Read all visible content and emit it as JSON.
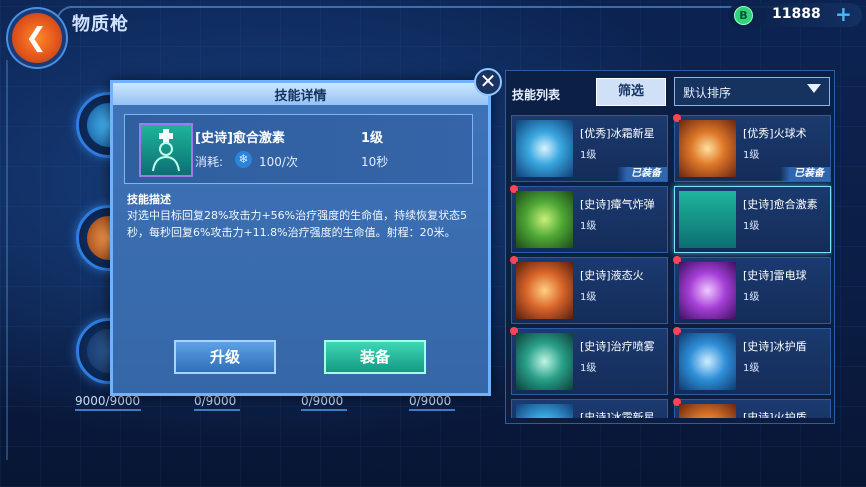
{
  "header": {
    "title": "物质枪",
    "back_icon": "back-arrow-icon"
  },
  "currency": {
    "icon": "B",
    "value": "11888",
    "add_label": "+"
  },
  "slots": {
    "progress": [
      "9000/9000",
      "0/9000",
      "0/9000",
      "0/9000"
    ]
  },
  "dialog": {
    "title": "技能详情",
    "close_label": "✕",
    "skill": {
      "name": "[史诗]愈合激素",
      "level": "1级",
      "cost_label": "消耗:",
      "cost_icon": "❄",
      "cost_value": "100/次",
      "cooldown": "10秒"
    },
    "description_title": "技能描述",
    "description": "对选中目标回复28%攻击力+56%治疗强度的生命值，持续恢复状态5秒，每秒回复6%攻击力+11.8%治疗强度的生命值。射程：20米。",
    "upgrade_label": "升级",
    "equip_label": "装备"
  },
  "skill_list": {
    "title": "技能列表",
    "filter_label": "筛选",
    "sort_value": "默认排序",
    "items": [
      {
        "name": "[优秀]冰霜新星",
        "level": "1级",
        "tag": "已装备",
        "color": "#3aa7e0"
      },
      {
        "name": "[优秀]火球术",
        "level": "1级",
        "tag": "已装备",
        "color": "#e07a2a"
      },
      {
        "name": "[史诗]瘴气炸弹",
        "level": "1级",
        "tag": "",
        "color": "#4fa836"
      },
      {
        "name": "[史诗]愈合激素",
        "level": "1级",
        "tag": "",
        "color": "#1fb59a"
      },
      {
        "name": "[史诗]液态火",
        "level": "1级",
        "tag": "",
        "color": "#d9652a"
      },
      {
        "name": "[史诗]雷电球",
        "level": "1级",
        "tag": "",
        "color": "#a63fd8"
      },
      {
        "name": "[史诗]治疗喷雾",
        "level": "1级",
        "tag": "",
        "color": "#2aa08a"
      },
      {
        "name": "[史诗]冰护盾",
        "level": "1级",
        "tag": "",
        "color": "#2f8fd8"
      },
      {
        "name": "[史诗]冰霜新星",
        "level": "",
        "tag": "",
        "color": "#3aa7e0"
      },
      {
        "name": "[史诗]火护盾",
        "level": "",
        "tag": "",
        "color": "#e07a2a"
      }
    ]
  }
}
